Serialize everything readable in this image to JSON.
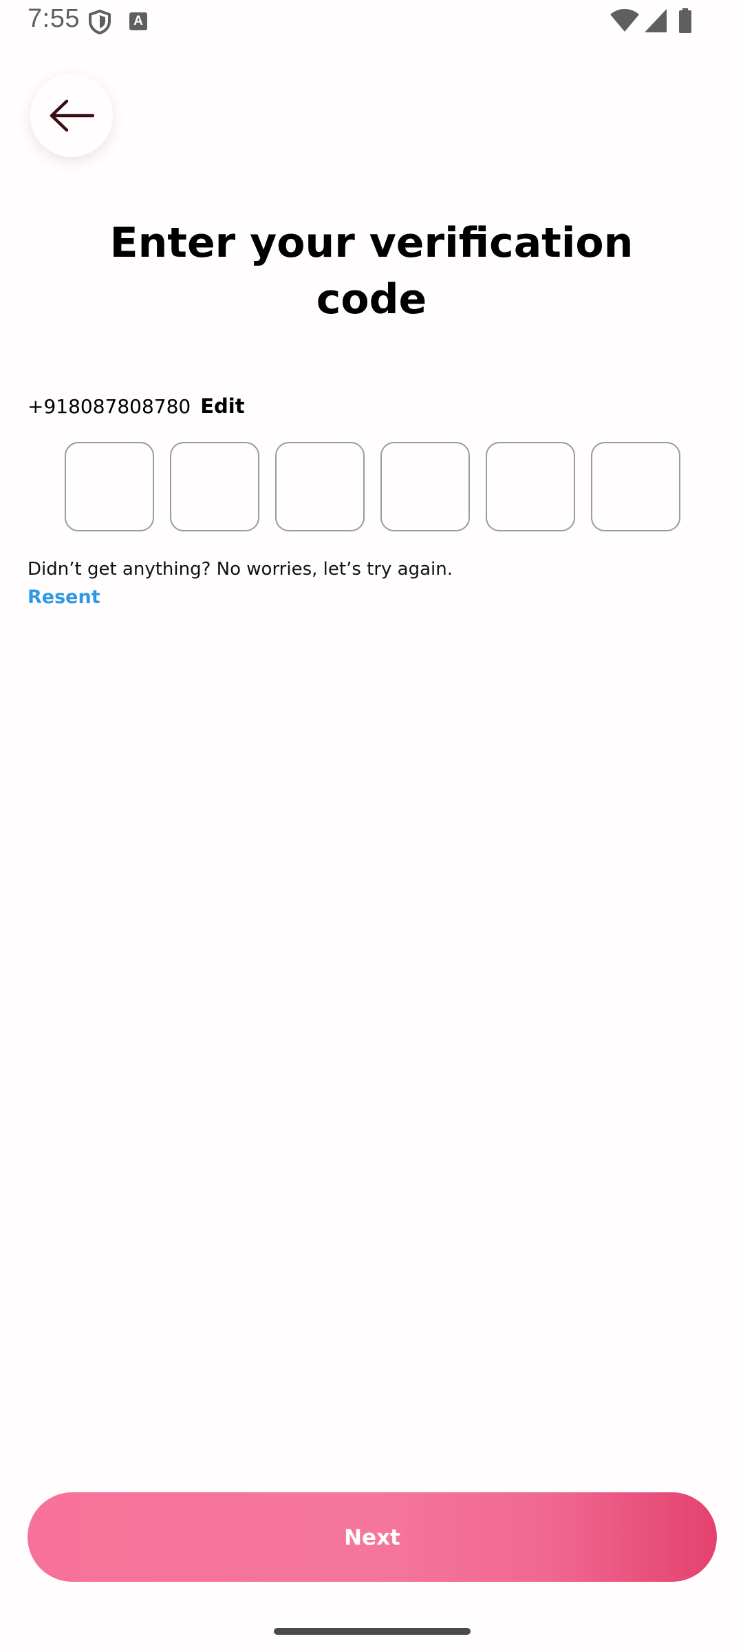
{
  "status_bar": {
    "time": "7:55",
    "icons": [
      "shield-icon",
      "keyboard-a-icon",
      "wifi-icon",
      "signal-icon",
      "battery-icon"
    ],
    "keyboard_badge": "A"
  },
  "header": {
    "back_icon": "arrow-left-icon"
  },
  "title": "Enter your verification code",
  "phone": {
    "number": "+918087808780",
    "edit_label": "Edit"
  },
  "code": {
    "length": 6,
    "digits": [
      "",
      "",
      "",
      "",
      "",
      ""
    ]
  },
  "resend": {
    "hint": "Didn’t get anything? No worries, let’s try again.",
    "link_label": "Resent"
  },
  "footer": {
    "next_label": "Next"
  },
  "colors": {
    "accent_link": "#2f97e4",
    "button_gradient_start": "#f6729a",
    "button_gradient_end": "#e4426f",
    "back_arrow": "#3a0d14"
  }
}
